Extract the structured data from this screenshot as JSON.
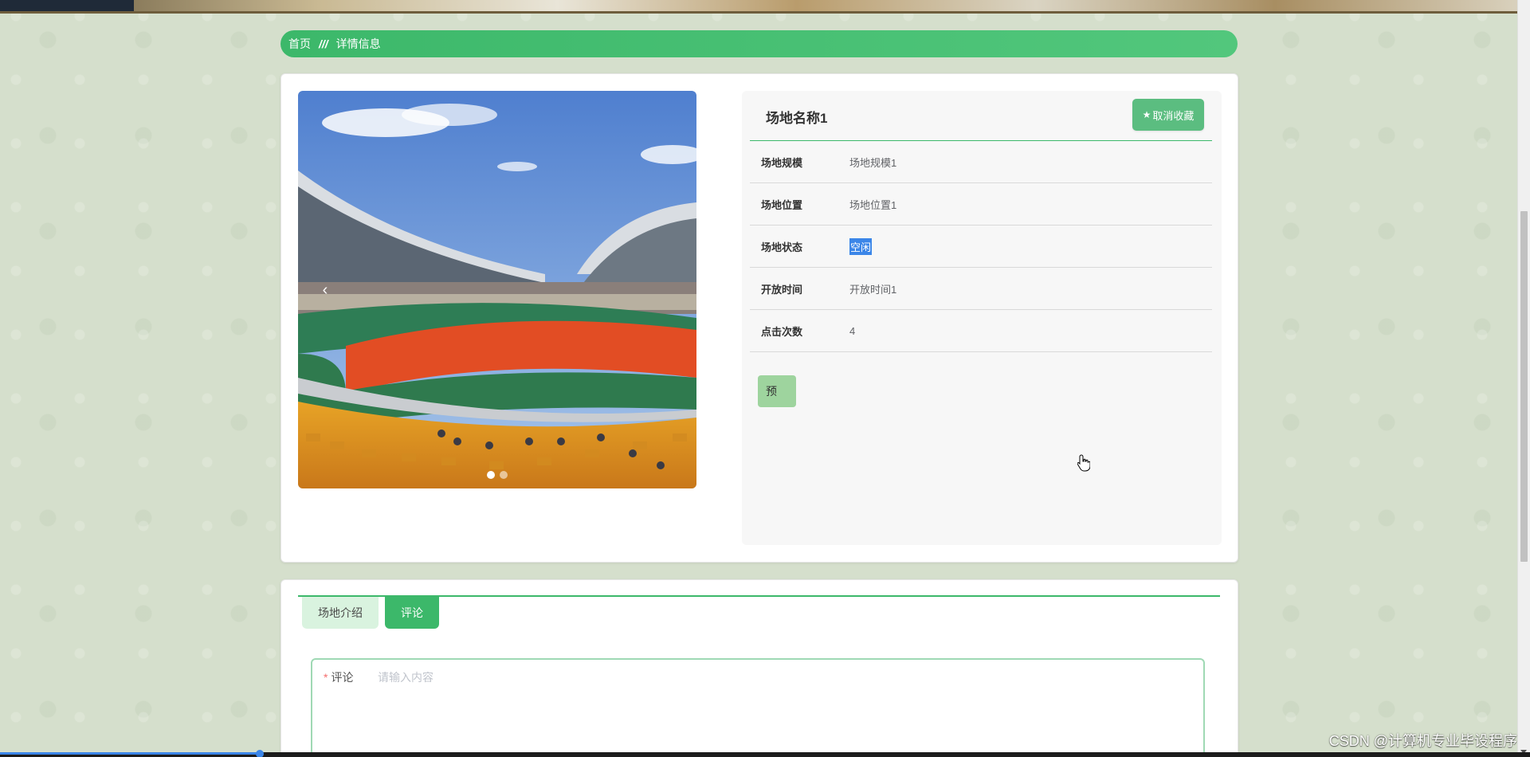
{
  "breadcrumb": {
    "home": "首页",
    "separator": "///",
    "current": "详情信息"
  },
  "venue": {
    "name": "场地名称1",
    "favorite_label": "取消收藏",
    "favorite_icon": "star-icon",
    "fields": [
      {
        "label": "场地规模",
        "value": "场地规模1"
      },
      {
        "label": "场地位置",
        "value": "场地位置1"
      },
      {
        "label": "场地状态",
        "value": "空闲"
      },
      {
        "label": "开放时间",
        "value": "开放时间1"
      },
      {
        "label": "点击次数",
        "value": "4"
      }
    ],
    "book_label": "预"
  },
  "carousel": {
    "prev_icon": "chevron-left-icon",
    "slide_count": 2,
    "active_slide": 1
  },
  "tabs": [
    {
      "label": "场地介绍",
      "active": false
    },
    {
      "label": "评论",
      "active": true
    }
  ],
  "comment": {
    "label": "评论",
    "required_mark": "*",
    "placeholder": "请输入内容"
  },
  "video_progress": 0.17,
  "watermark": "CSDN @计算机专业毕设程序",
  "colors": {
    "accent": "#3cb86a",
    "tab_inactive_bg": "#d9f3df",
    "selection": "#3b86e8",
    "required": "#f56c6c"
  }
}
